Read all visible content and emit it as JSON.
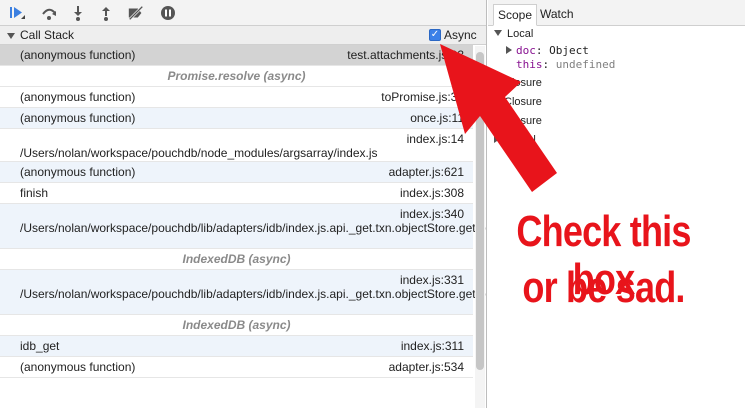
{
  "toolbar": {
    "buttons": [
      {
        "name": "resume-icon",
        "icon": "play-pause"
      },
      {
        "name": "step-over-icon",
        "icon": "step-over"
      },
      {
        "name": "step-into-icon",
        "icon": "step-into"
      },
      {
        "name": "step-out-icon",
        "icon": "step-out"
      },
      {
        "name": "deactivate-breakpoints-icon",
        "icon": "breakpoints-off"
      },
      {
        "name": "pause-on-exceptions-icon",
        "icon": "pause"
      }
    ]
  },
  "callstack": {
    "title": "Call Stack",
    "async_label": "Async",
    "async_checked": true,
    "frames": [
      {
        "fn": "(anonymous function)",
        "loc": "test.attachments.js:93"
      },
      {
        "separator": "Promise.resolve (async)"
      },
      {
        "fn": "(anonymous function)",
        "loc": "toPromise.js:31"
      },
      {
        "fn": "(anonymous function)",
        "loc": "once.js:11"
      },
      {
        "loc": "index.js:14",
        "path": "/Users/nolan/workspace/pouchdb/node_modules/argsarray/index.js"
      },
      {
        "fn": "(anonymous function)",
        "loc": "adapter.js:621"
      },
      {
        "fn": "finish",
        "loc": "index.js:308"
      },
      {
        "loc": "index.js:340",
        "path": "/Users/nolan/workspace/pouchdb/lib/adapters/idb/index.js.api._get.txn.objectStore.get.onsuccess.objectStore.index.get.onsuccess"
      },
      {
        "separator": "IndexedDB (async)"
      },
      {
        "loc": "index.js:331",
        "path": "/Users/nolan/workspace/pouchdb/lib/adapters/idb/index.js.api._get.txn.objectStore.get.onsuccess"
      },
      {
        "separator": "IndexedDB (async)"
      },
      {
        "fn": "idb_get",
        "loc": "index.js:311"
      },
      {
        "fn": "(anonymous function)",
        "loc": "adapter.js:534"
      }
    ]
  },
  "sidebar": {
    "tabs": [
      {
        "label": "Scope",
        "active": true
      },
      {
        "label": "Watch",
        "active": false
      }
    ],
    "scope": {
      "local_label": "Local",
      "doc_key": "doc",
      "doc_value": "Object",
      "this_key": "this",
      "this_value": "undefined",
      "closures": [
        "Closure",
        "Closure",
        "Closure"
      ],
      "global_label": "Global"
    }
  },
  "annotation": {
    "line1": "Check this box",
    "line2": "or be sad.",
    "color": "#e8141b"
  }
}
